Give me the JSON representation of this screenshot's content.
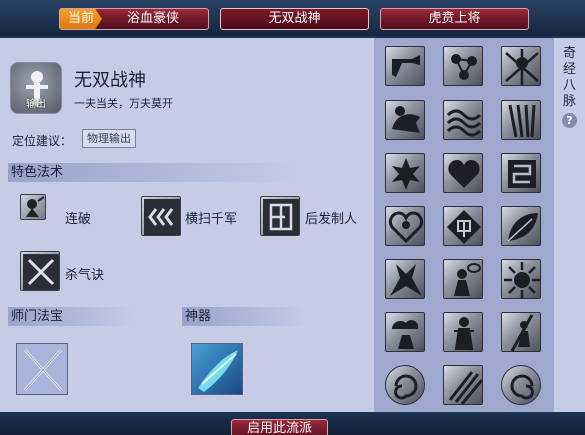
{
  "tabs": [
    {
      "label": "浴血豪侠",
      "current_label": "当前"
    },
    {
      "label": "无双战神"
    },
    {
      "label": "虎贲上将"
    }
  ],
  "school": {
    "name": "无双战神",
    "description": "一夫当关，万夫莫开",
    "avatar_caption": "输出"
  },
  "role": {
    "label": "定位建议：",
    "value": "物理输出"
  },
  "special_skills": {
    "title": "特色法术",
    "items": [
      {
        "name": "连破",
        "icon": "warrior-strike-icon"
      },
      {
        "name": "横扫千军",
        "icon": "triple-chevron-icon"
      },
      {
        "name": "后发制人",
        "icon": "counter-glyph-icon"
      },
      {
        "name": "杀气诀",
        "icon": "crossed-swords-icon"
      }
    ]
  },
  "treasure": {
    "title": "师门法宝",
    "icon": "crossed-blades-icon"
  },
  "artifact": {
    "title": "神器",
    "icon": "dragon-blade-icon"
  },
  "qijing": {
    "label": "奇经八脉",
    "help_glyph": "?"
  },
  "enable_button": "启用此流派"
}
